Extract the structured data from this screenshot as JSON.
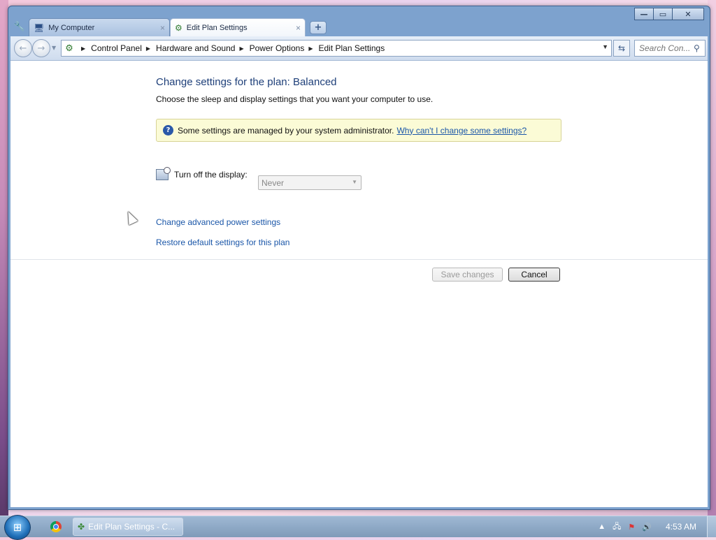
{
  "window": {
    "controls": {
      "minimize": "—",
      "maximize": "▭",
      "close": "✕"
    }
  },
  "tabs": [
    {
      "label": "My Computer",
      "icon": "computer-icon",
      "close": "×"
    },
    {
      "label": "Edit Plan Settings",
      "icon": "power-plan-icon",
      "close": "×",
      "active": true
    }
  ],
  "new_tab": "+",
  "nav": {
    "back": "←",
    "forward": "→",
    "breadcrumb": [
      "Control Panel",
      "Hardware and Sound",
      "Power Options",
      "Edit Plan Settings"
    ],
    "search_placeholder": "Search Con..."
  },
  "page": {
    "title": "Change settings for the plan: Balanced",
    "subtitle": "Choose the sleep and display settings that you want your computer to use.",
    "info_text": "Some settings are managed by your system administrator.",
    "info_link": "Why can't I change some settings?",
    "display_label": "Turn off the display:",
    "display_value": "Never",
    "link_advanced": "Change advanced power settings",
    "link_restore": "Restore default settings for this plan",
    "save_label": "Save changes",
    "cancel_label": "Cancel"
  },
  "taskbar": {
    "task_label": "Edit Plan Settings - C...",
    "clock": "4:53 AM"
  },
  "colors": {
    "accent_title": "#1e3f79",
    "link": "#1a56a8",
    "info_bg": "#fbfbd6"
  }
}
